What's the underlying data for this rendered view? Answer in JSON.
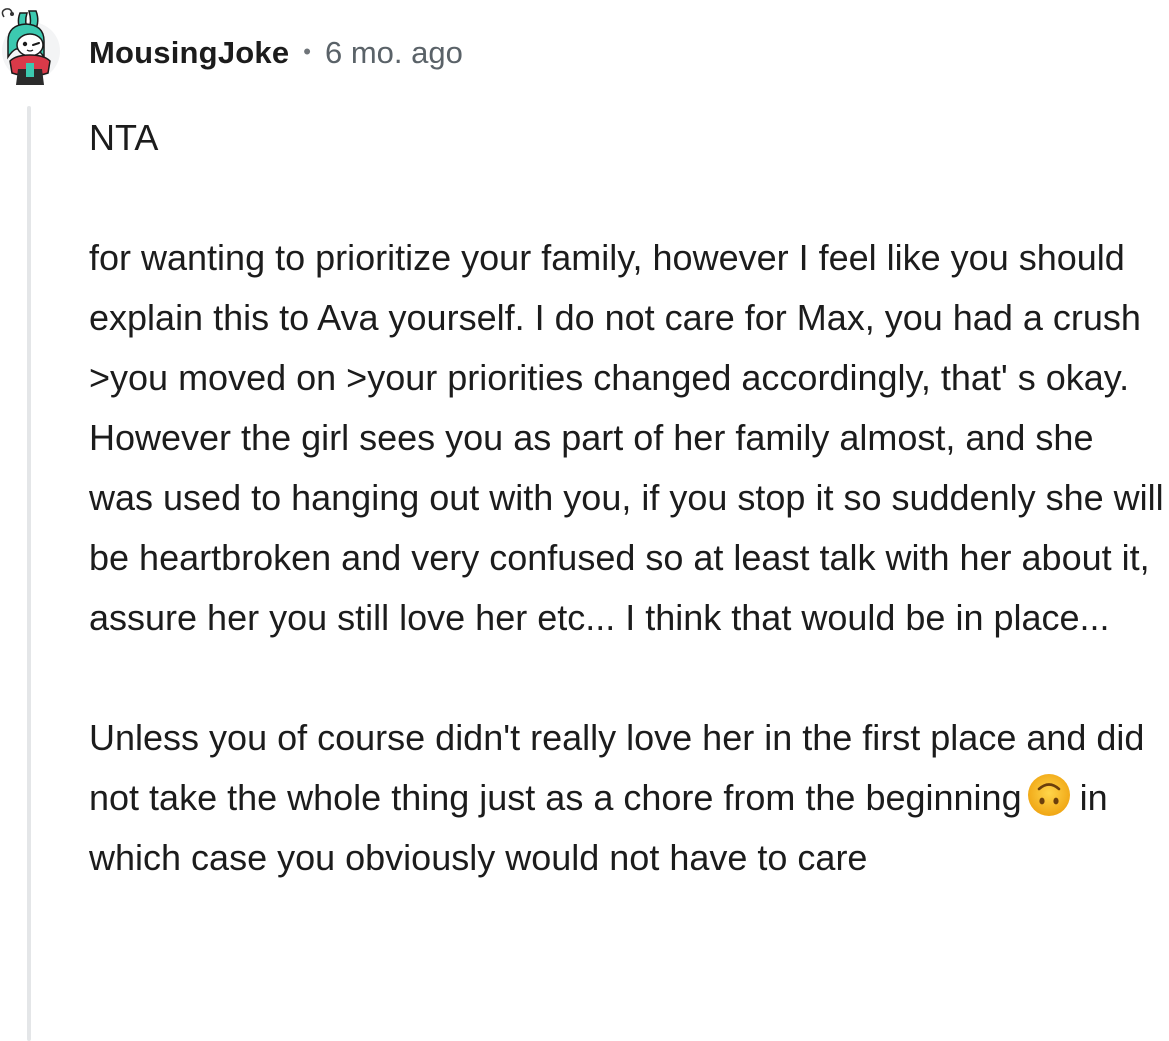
{
  "comment": {
    "author": "MousingJoke",
    "separator": "•",
    "timestamp": "6 mo. ago",
    "paragraphs": [
      "NTA",
      "for wanting to prioritize your family, however I feel like you should explain this to Ava yourself. I do not care for Max, you had a crush >you moved on >your priorities changed accordingly, that' s okay. However the girl sees you as part of her family almost, and she was used to hanging out with you, if you stop it so suddenly she will be heartbroken and very confused so at least talk with her about it, assure her you still love her etc... I think that would be in place...",
      "Unless you of course didn't really love her in the first place and did not take the whole thing just as a chore from the beginning"
    ],
    "last_paragraph_after_emoji": "in which case you obviously would not have to care",
    "emoji": "upside-down-face",
    "avatar_icon": "snoo-avatar-icon",
    "colors": {
      "thread_line": "#e4e6e8",
      "author_text": "#1c1c1c",
      "meta_text": "#5a6268",
      "emoji_face": "#f5b51d"
    }
  }
}
